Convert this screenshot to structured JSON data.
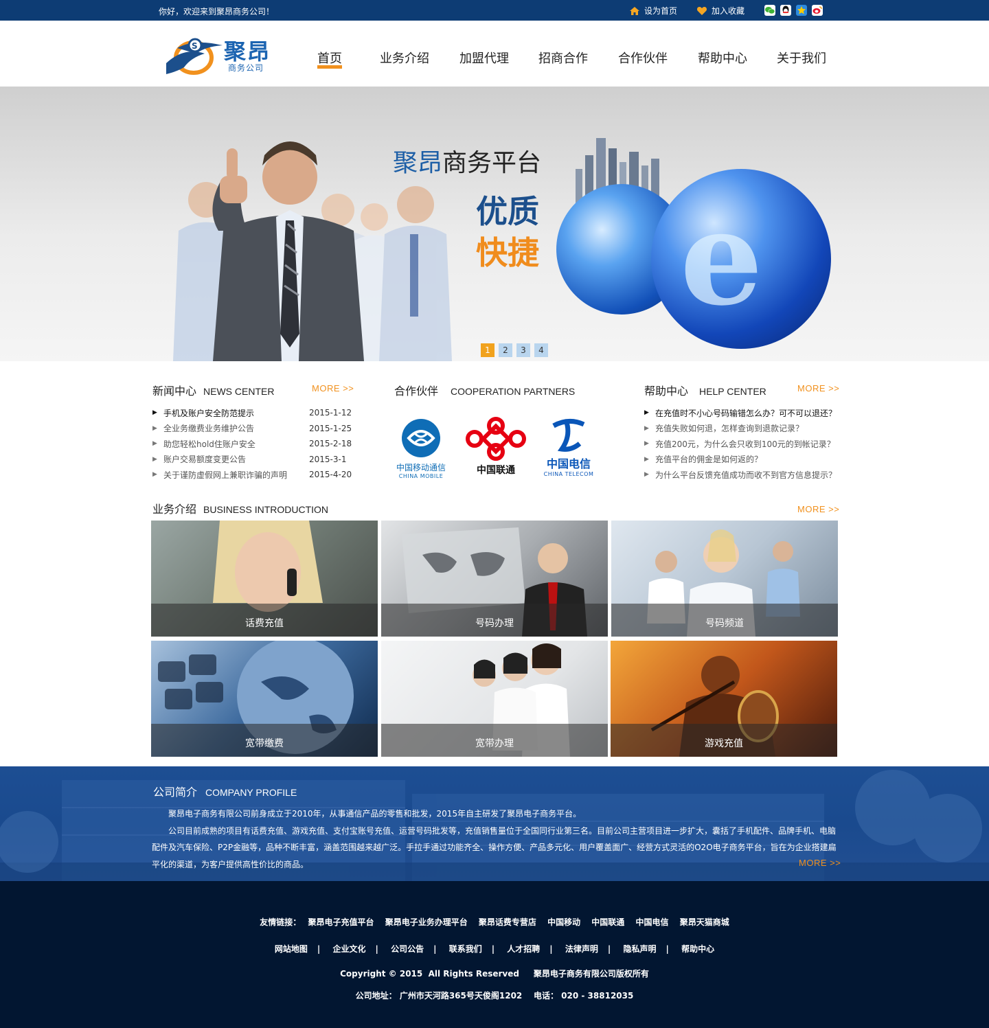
{
  "topbar": {
    "welcome": "你好，欢迎来到聚昂商务公司！",
    "set_home": "设为首页",
    "add_favorite": "加入收藏",
    "social_icons": [
      "wechat-icon",
      "qq-icon",
      "qzone-icon",
      "weibo-icon"
    ]
  },
  "header": {
    "logo_name": "聚昂",
    "logo_sub": "商务公司",
    "nav": [
      "首页",
      "业务介绍",
      "加盟代理",
      "招商合作",
      "合作伙伴",
      "帮助中心",
      "关于我们"
    ],
    "active_nav": "首页",
    "accent_color": "#f1911e"
  },
  "banner": {
    "title_brand": "聚昂",
    "title_rest": "商务平台",
    "slogan_1": "优质",
    "slogan_2": "快捷",
    "pages": [
      "1",
      "2",
      "3",
      "4"
    ],
    "active_page": "1"
  },
  "news": {
    "title_cn": "新闻中心",
    "title_en": "NEWS CENTER",
    "more": "MORE >>",
    "items": [
      {
        "text": "手机及账户安全防范提示",
        "date": "2015-1-12"
      },
      {
        "text": "全业务缴费业务维护公告",
        "date": "2015-1-25"
      },
      {
        "text": "助您轻松hold住账户安全",
        "date": "2015-2-18"
      },
      {
        "text": "账户交易额度变更公告",
        "date": "2015-3-1"
      },
      {
        "text": "关于谨防虚假网上兼职诈骗的声明",
        "date": "2015-4-20"
      }
    ]
  },
  "partners": {
    "title_cn": "合作伙伴",
    "title_en": "COOPERATION PARTNERS",
    "items": [
      {
        "cn": "中国移动通信",
        "en": "CHINA MOBILE",
        "color": "#0f6db6"
      },
      {
        "cn": "中国联通",
        "en": "",
        "color": "#e60012"
      },
      {
        "cn": "中国电信",
        "en": "CHINA TELECOM",
        "color": "#0a56b8"
      }
    ]
  },
  "help": {
    "title_cn": "帮助中心",
    "title_en": "HELP CENTER",
    "more": "MORE >>",
    "items": [
      "在充值时不小心号码输错怎么办？可不可以退还？",
      "充值失败如何退，怎样查询到退款记录？",
      "充值200元，为什么会只收到100元的到帐记录？",
      "充值平台的佣金是如何返的？",
      "为什么平台反馈充值成功而收不到官方信息提示？"
    ]
  },
  "business": {
    "title_cn": "业务介绍",
    "title_en": "BUSINESS INTRODUCTION",
    "more": "MORE >>",
    "tiles": [
      "话费充值",
      "号码办理",
      "号码频道",
      "宽带缴费",
      "宽带办理",
      "游戏充值"
    ]
  },
  "profile": {
    "title_cn": "公司简介",
    "title_en": "COMPANY PROFILE",
    "para_1": "聚昂电子商务有限公司前身成立于2010年，从事通信产品的零售和批发，2015年自主研发了聚昂电子商务平台。",
    "para_2": "公司目前成熟的项目有话费充值、游戏充值、支付宝账号充值、运营号码批发等，充值销售量位于全国同行业第三名。目前公司主营项目进一步扩大，囊括了手机配件、品牌手机、电脑配件及汽车保险、P2P金融等，品种不断丰富，涵盖范围越来越广泛。手拉手通过功能齐全、操作方便、产品多元化、用户覆盖面广、经营方式灵活的O2O电子商务平台，旨在为企业搭建扁平化的渠道，为客户提供高性价比的商品。",
    "more": "MORE >>"
  },
  "footer": {
    "links_label": "友情链接：",
    "links": [
      "聚昂电子充值平台",
      "聚昂电子业务办理平台",
      "聚昂话费专营店",
      "中国移动",
      "中国联通",
      "中国电信",
      "聚昂天猫商城"
    ],
    "nav": [
      "网站地图",
      "企业文化",
      "公司公告",
      "联系我们",
      "人才招聘",
      "法律声明",
      "隐私声明",
      "帮助中心"
    ],
    "separator": "|",
    "copyright": "Copyright © 2015  All Rights Reserved     聚昂电子商务有限公司版权所有",
    "address": "公司地址： 广州市天河路365号天俊阁1202    电话： 020 - 38812035"
  }
}
